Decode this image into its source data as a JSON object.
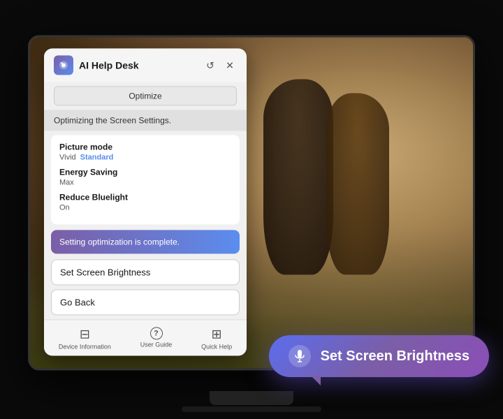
{
  "app": {
    "title": "AI Help Desk"
  },
  "header": {
    "title": "AI Help Desk",
    "optimize_label": "Optimize",
    "reset_icon": "↺",
    "close_icon": "✕"
  },
  "status": {
    "text": "Optimizing the Screen Settings."
  },
  "settings": {
    "items": [
      {
        "label": "Picture mode",
        "value1": "Vivid",
        "value2": "Standard",
        "value2_active": true
      },
      {
        "label": "Energy Saving",
        "value1": "Max",
        "value2": "",
        "value2_active": false
      },
      {
        "label": "Reduce Bluelight",
        "value1": "On",
        "value2": "",
        "value2_active": false
      }
    ]
  },
  "complete_banner": {
    "text": "Setting optimization is complete."
  },
  "buttons": {
    "set_brightness": "Set Screen Brightness",
    "go_back": "Go Back"
  },
  "footer": {
    "items": [
      {
        "icon": "⊟",
        "label": "Device Information"
      },
      {
        "icon": "?",
        "label": "User Guide"
      },
      {
        "icon": "⊡",
        "label": "Quick Help"
      }
    ]
  },
  "voice_bubble": {
    "text": "Set Screen Brightness",
    "mic_symbol": "🎤"
  }
}
